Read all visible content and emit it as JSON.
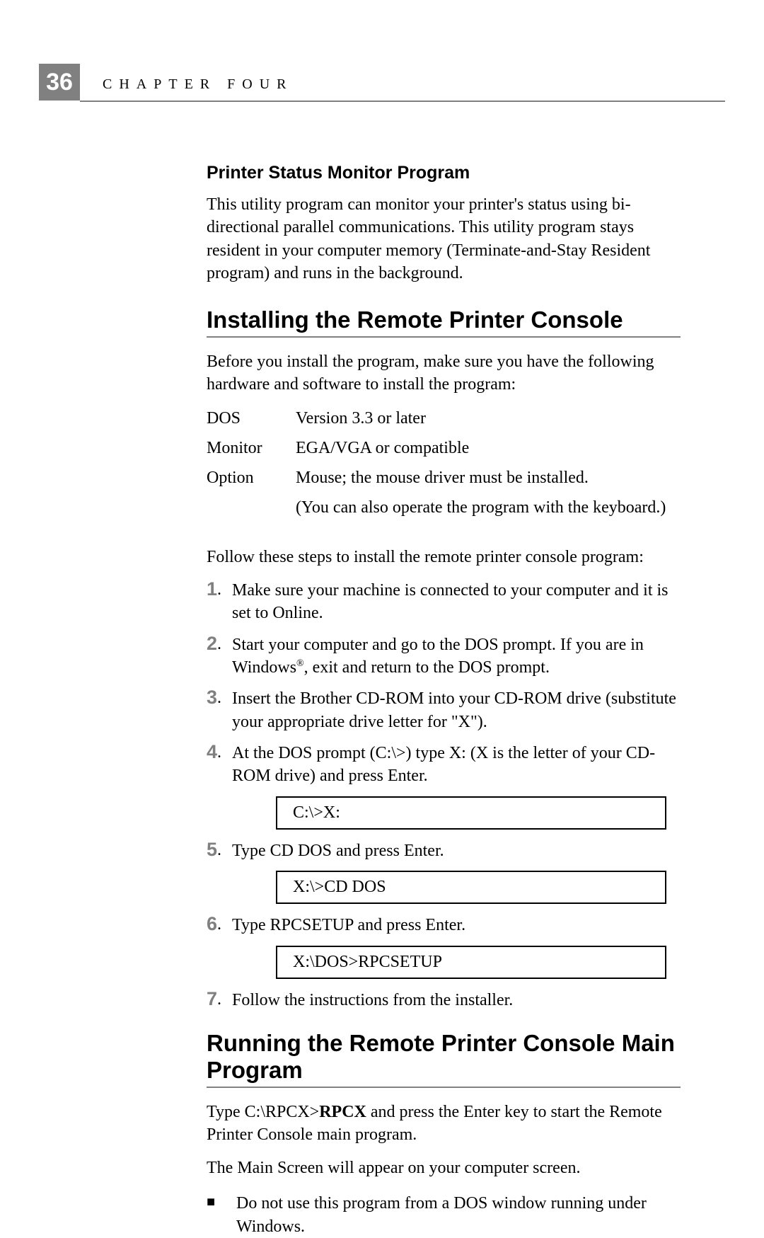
{
  "header": {
    "page_number": "36",
    "chapter_label": "CHAPTER FOUR"
  },
  "sections": {
    "status_monitor": {
      "heading": "Printer Status Monitor Program",
      "para": "This utility program can monitor your printer's status using bi-directional parallel communications. This utility program stays resident in your computer memory (Terminate-and-Stay Resident program) and runs in the background."
    },
    "installing": {
      "heading": "Installing the Remote Printer Console",
      "intro": "Before you install the program, make sure you have the following hardware and software to install the program:",
      "requirements": [
        {
          "label": "DOS",
          "value": "Version 3.3 or later"
        },
        {
          "label": "Monitor",
          "value": "EGA/VGA or compatible"
        },
        {
          "label": "Option",
          "value": "Mouse; the mouse driver must be installed."
        },
        {
          "label": "",
          "value": "(You can also operate the program with the keyboard.)"
        }
      ],
      "follow": "Follow these steps to install the remote printer console program:",
      "steps": {
        "s1": "Make sure your machine is connected to your computer and it is set to Online.",
        "s2a": "Start your computer and go to the DOS prompt. If you are in Windows",
        "s2b": ", exit and return to the DOS prompt.",
        "s3": "Insert the Brother CD-ROM into your CD-ROM drive (substitute your appropriate drive letter for \"X\").",
        "s4": "At the DOS prompt (C:\\>) type X: (X is the letter of your CD-ROM drive) and press Enter.",
        "code4": "C:\\>X:",
        "s5": "Type CD DOS and press Enter.",
        "code5": "X:\\>CD DOS",
        "s6": "Type RPCSETUP and press Enter.",
        "code6": "X:\\DOS>RPCSETUP",
        "s7": "Follow the instructions from the installer."
      }
    },
    "running": {
      "heading": "Running the Remote Printer Console Main Program",
      "para1a": "Type C:\\RPCX>",
      "para1b": "RPCX",
      "para1c": " and press the Enter key to start the Remote Printer Console main program.",
      "para2": "The Main Screen will appear on your computer screen.",
      "bullet": "Do not use this program from a DOS window running under Windows."
    }
  }
}
